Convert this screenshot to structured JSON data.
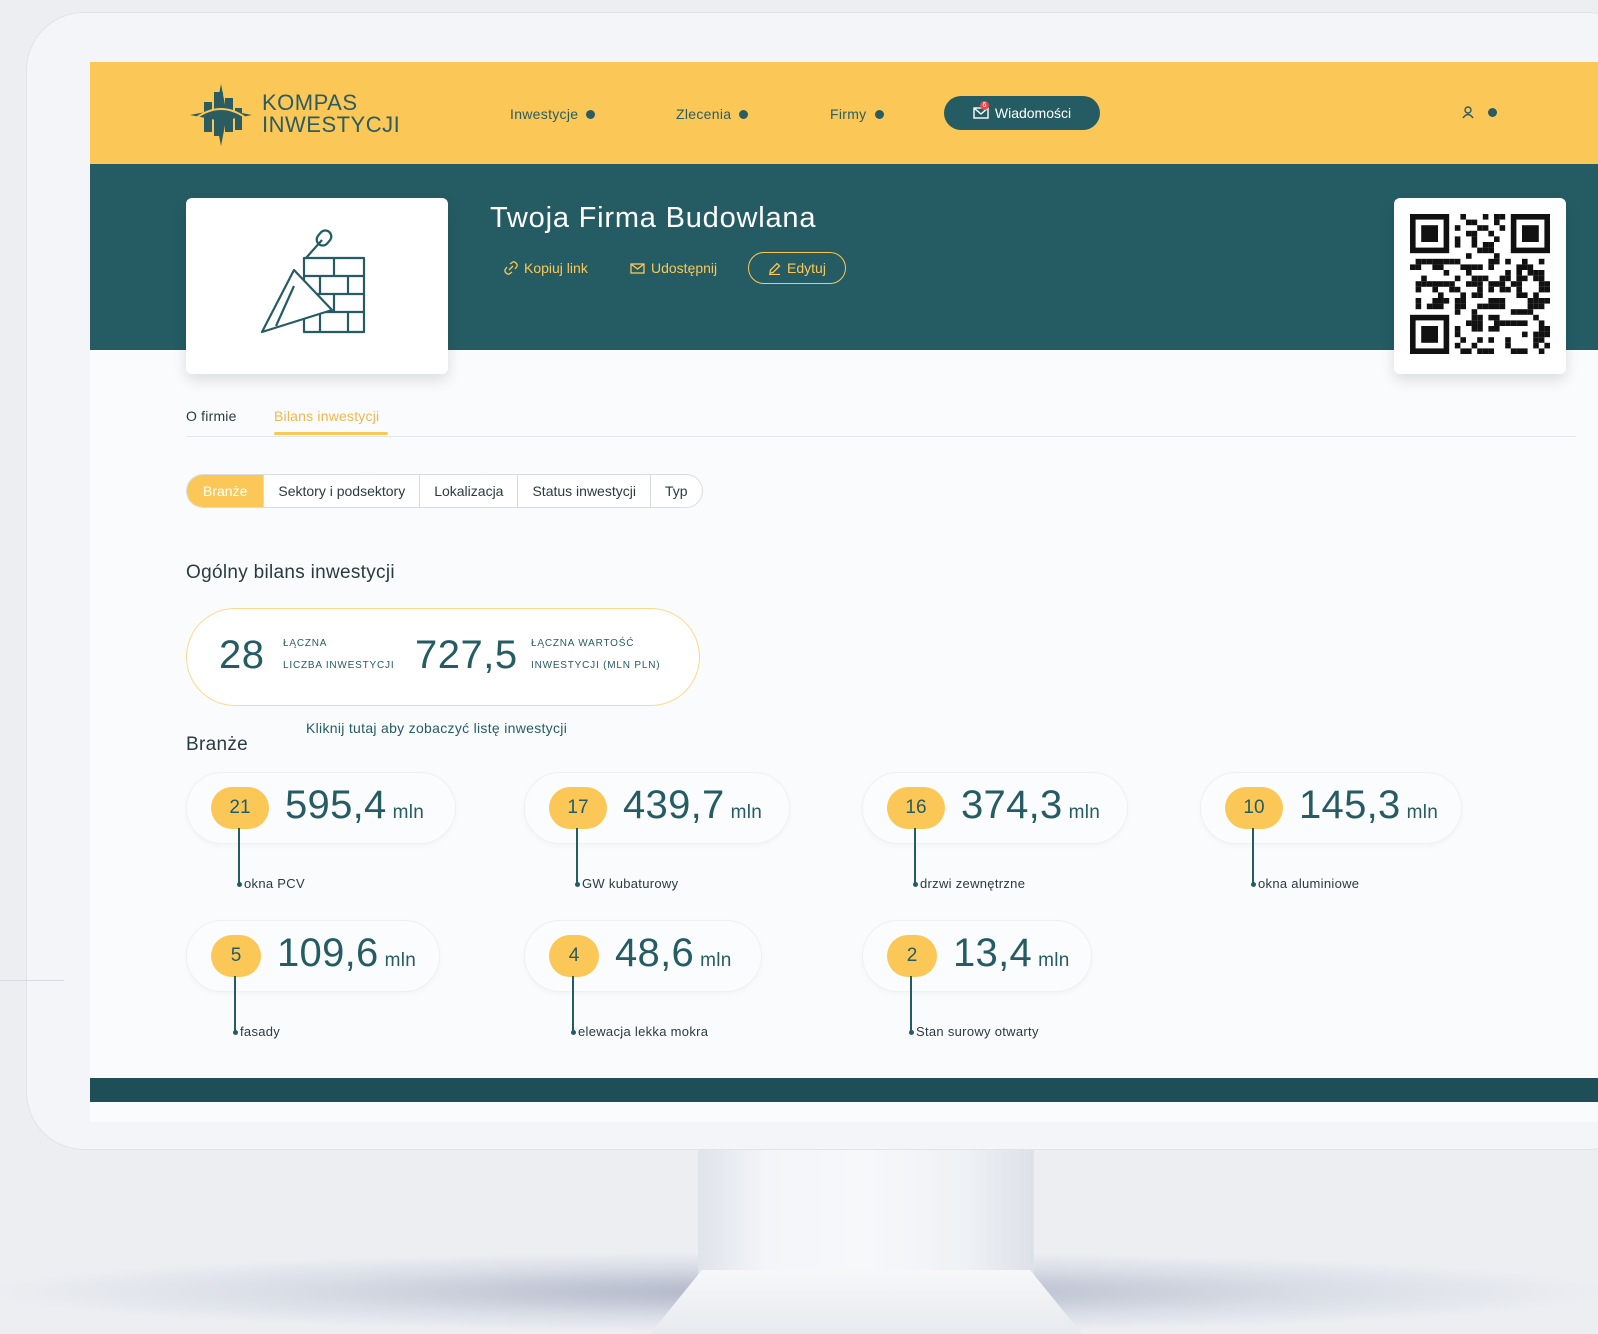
{
  "brand": {
    "line1": "KOMPAS",
    "line2": "INWESTYCJI"
  },
  "nav": {
    "items": [
      {
        "label": "Inwestycje"
      },
      {
        "label": "Zlecenia"
      },
      {
        "label": "Firmy"
      }
    ],
    "messages": {
      "label": "Wiadomości",
      "badge": "6"
    }
  },
  "company": {
    "title": "Twoja Firma Budowlana",
    "actions": {
      "copy_link": "Kopiuj link",
      "share": "Udostępnij",
      "edit": "Edytuj"
    }
  },
  "tabs": [
    {
      "label": "O firmie"
    },
    {
      "label": "Bilans inwestycji"
    }
  ],
  "segments": [
    {
      "label": "Branże"
    },
    {
      "label": "Sektory i podsektory"
    },
    {
      "label": "Lokalizacja"
    },
    {
      "label": "Status inwestycji"
    },
    {
      "label": "Typ"
    }
  ],
  "summary": {
    "heading": "Ogólny bilans inwestycji",
    "count": "28",
    "count_label_1": "łączna",
    "count_label_2": "liczba inwestycji",
    "value": "727,5",
    "value_label_1": "łączna wartość",
    "value_label_2": "inwestycji (mln pln)",
    "link": "Kliknij tutaj aby zobaczyć listę inwestycji"
  },
  "industries": {
    "heading": "Branże",
    "unit": "mln",
    "items": [
      {
        "count": "21",
        "value": "595,4",
        "label": "okna PCV"
      },
      {
        "count": "17",
        "value": "439,7",
        "label": "GW kubaturowy"
      },
      {
        "count": "16",
        "value": "374,3",
        "label": "drzwi zewnętrzne"
      },
      {
        "count": "10",
        "value": "145,3",
        "label": "okna aluminiowe"
      },
      {
        "count": "5",
        "value": "109,6",
        "label": "fasady"
      },
      {
        "count": "4",
        "value": "48,6",
        "label": "elewacja lekka mokra"
      },
      {
        "count": "2",
        "value": "13,4",
        "label": "Stan surowy otwarty"
      }
    ]
  },
  "colors": {
    "accent": "#fbc857",
    "teal": "#255c63",
    "dark": "#1f4f56"
  }
}
